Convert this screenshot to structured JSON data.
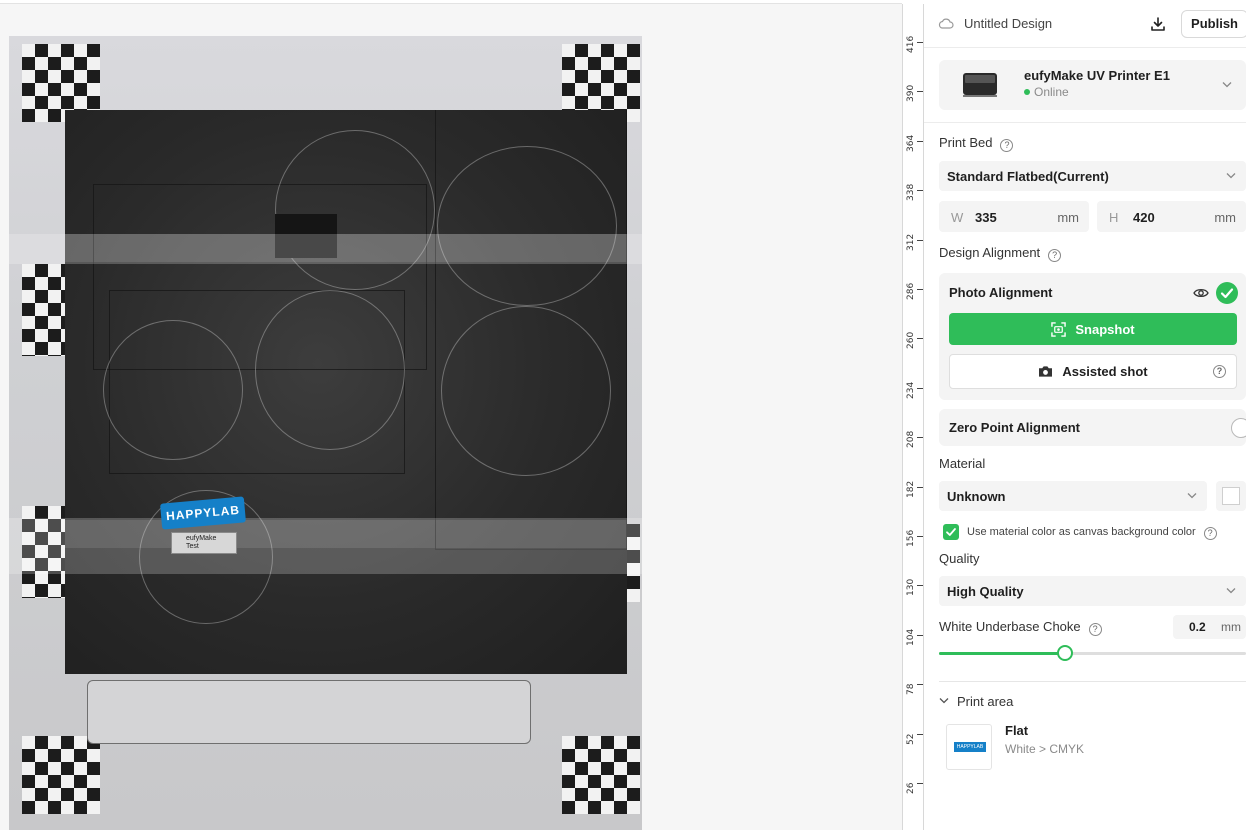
{
  "header": {
    "title": "Untitled Design",
    "publish_label": "Publish"
  },
  "printer": {
    "name": "eufyMake UV Printer E1",
    "status": "Online"
  },
  "print_bed": {
    "label": "Print Bed",
    "selected": "Standard Flatbed(Current)",
    "width_prefix": "W",
    "width": "335",
    "height_prefix": "H",
    "height": "420",
    "unit": "mm"
  },
  "design_alignment": {
    "label": "Design Alignment",
    "photo_title": "Photo Alignment",
    "snapshot_label": "Snapshot",
    "assisted_label": "Assisted shot",
    "zero_title": "Zero Point Alignment"
  },
  "material": {
    "label": "Material",
    "selected": "Unknown",
    "bg_checkbox_label": "Use material color as canvas background color"
  },
  "quality": {
    "label": "Quality",
    "selected": "High Quality"
  },
  "choke": {
    "label": "White Underbase Choke",
    "value": "0.2",
    "unit": "mm",
    "slider_fraction": 0.41
  },
  "print_area": {
    "label": "Print area",
    "item_title": "Flat",
    "item_sub": "White > CMYK"
  },
  "canvas": {
    "logo_text": "HAPPYLAB",
    "label_text_1": "eufyMake",
    "label_text_2": "Test",
    "ruler_labels": [
      "416",
      "390",
      "364",
      "338",
      "312",
      "286",
      "260",
      "234",
      "208",
      "182",
      "156",
      "130",
      "104",
      "78",
      "52",
      "26"
    ]
  },
  "colors": {
    "accent": "#2fbd59",
    "brand_blue": "#1580c8"
  },
  "icons": {
    "header": [
      "cloud-icon",
      "download-icon"
    ],
    "photo": [
      "eye-icon",
      "check-icon",
      "snapshot-icon",
      "camera-icon"
    ]
  }
}
